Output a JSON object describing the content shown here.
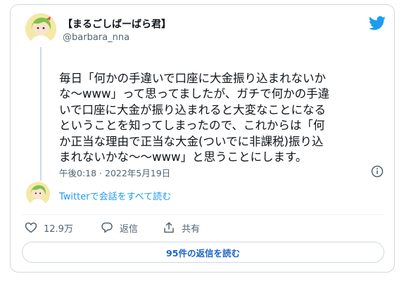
{
  "tweet": {
    "display_name": "【まるごしばーばら君】",
    "handle": "@barbara_nna",
    "text_lines": [
      "毎日「何かの手違いで口座に大金振り込まれないか",
      "な〜www」って思ってましたが、ガチで何かの手違",
      "いで口座に大金が振り込まれると大変なことになる",
      "ということを知ってしまったので、これからは「何",
      "か正当な理由で正当な大金(ついでに非課税)振り込",
      "まれないかな〜〜www」と思うことにします。"
    ],
    "timestamp": "午後0:18 · 2022年5月19日",
    "read_conversation": "Twitterで会話をすべて読む",
    "actions": {
      "like_count": "12.9万",
      "reply_label": "返信",
      "share_label": "共有"
    },
    "replies_button": "95件の返信を読む"
  },
  "icons": [
    "avatar",
    "twitter-bird-icon",
    "info-icon",
    "heart-icon",
    "reply-icon",
    "share-icon"
  ],
  "colors": {
    "accent": "#1d9bf0",
    "text": "#0f1419",
    "secondary": "#536471",
    "border": "#cfd9de"
  }
}
